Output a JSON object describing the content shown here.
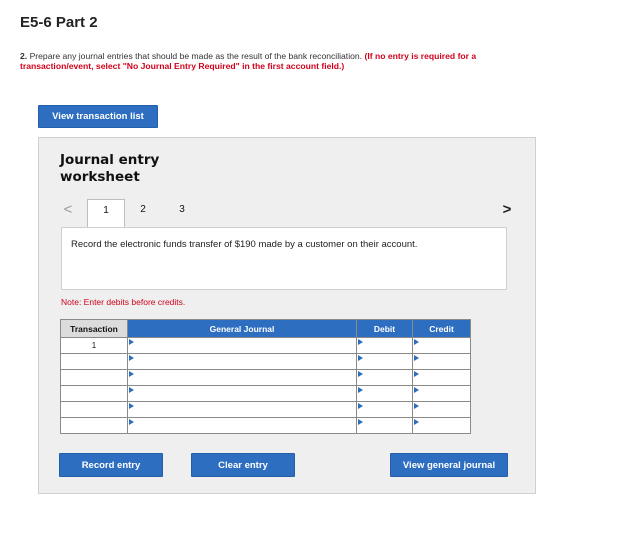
{
  "page": {
    "title": "E5-6 Part 2"
  },
  "question": {
    "number": "2.",
    "text": "Prepare any journal entries that should be made as the result of the bank reconciliation.",
    "instruction": "(If no entry is required for a transaction/event, select \"No Journal Entry Required\" in the first account field.)"
  },
  "buttons": {
    "view_transaction_list": "View transaction list",
    "record_entry": "Record entry",
    "clear_entry": "Clear entry",
    "view_general_journal": "View general journal"
  },
  "worksheet": {
    "title_line1": "Journal entry",
    "title_line2": "worksheet",
    "prev_arrow": "<",
    "next_arrow": ">",
    "pages": [
      "1",
      "2",
      "3"
    ],
    "active_page": "1",
    "transaction_description": "Record the electronic funds transfer of $190 made by a customer on their account.",
    "note": "Note: Enter debits before credits."
  },
  "journal_table": {
    "headers": {
      "transaction": "Transaction",
      "general_journal": "General Journal",
      "debit": "Debit",
      "credit": "Credit"
    },
    "rows": [
      {
        "transaction": "1",
        "account": "",
        "debit": "",
        "credit": ""
      },
      {
        "transaction": "",
        "account": "",
        "debit": "",
        "credit": ""
      },
      {
        "transaction": "",
        "account": "",
        "debit": "",
        "credit": ""
      },
      {
        "transaction": "",
        "account": "",
        "debit": "",
        "credit": ""
      },
      {
        "transaction": "",
        "account": "",
        "debit": "",
        "credit": ""
      },
      {
        "transaction": "",
        "account": "",
        "debit": "",
        "credit": ""
      }
    ]
  },
  "colors": {
    "accent_blue": "#2d6ec1",
    "instruction_red": "#d0021b",
    "worksheet_bg": "#efefef"
  }
}
